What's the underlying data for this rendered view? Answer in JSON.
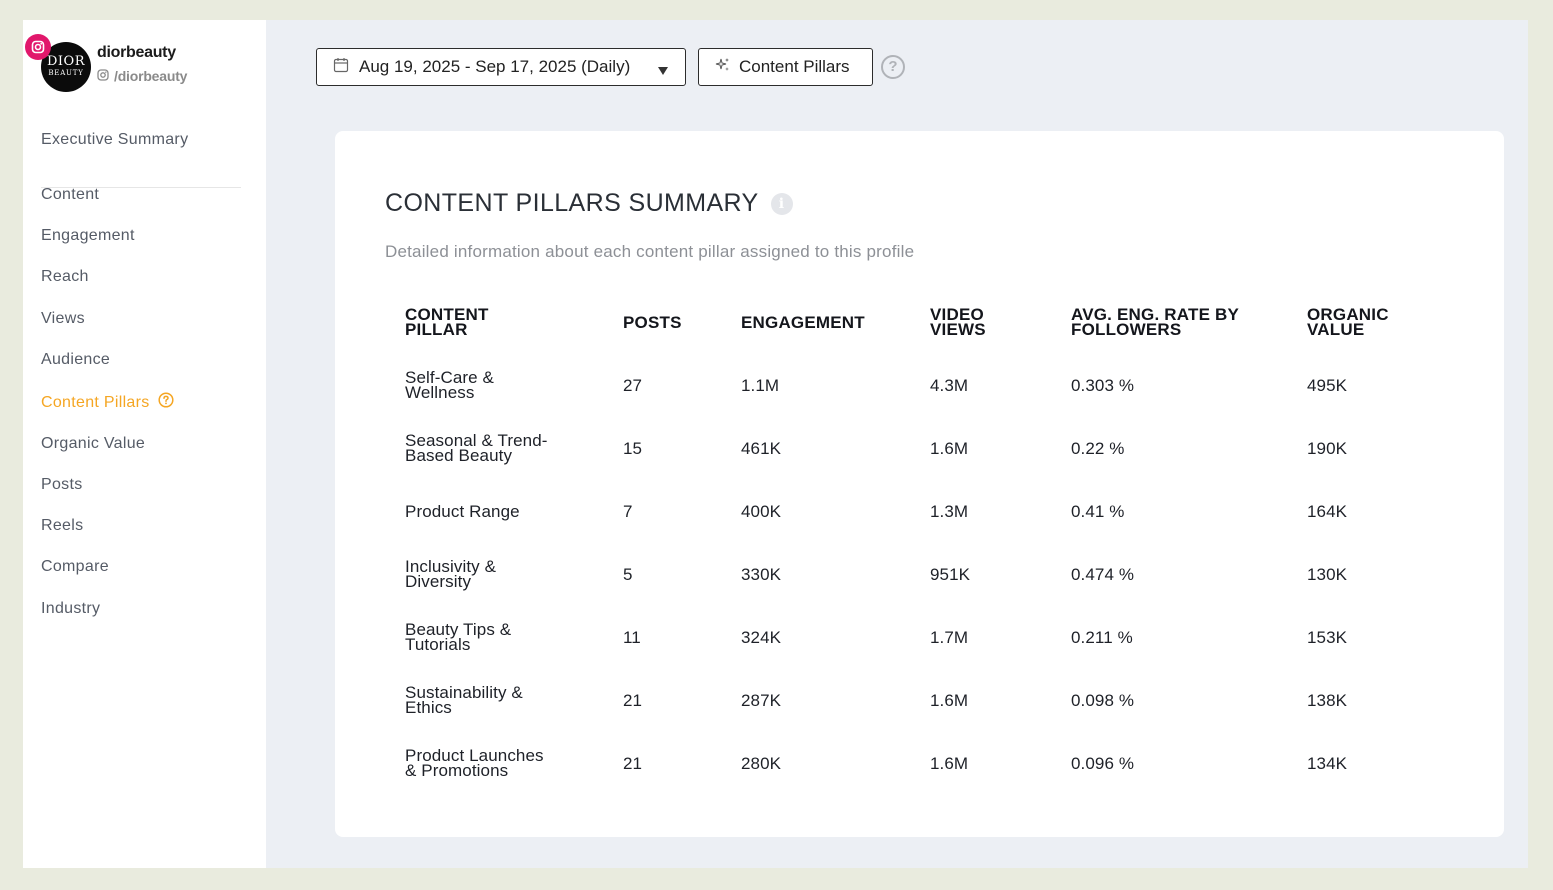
{
  "profile": {
    "name": "diorbeauty",
    "handle": "/diorbeauty",
    "avatar_line1": "DIOR",
    "avatar_line2": "BEAUTY"
  },
  "nav": {
    "items": [
      {
        "label": "Executive Summary",
        "active": false
      },
      {
        "label": "Content",
        "active": false
      },
      {
        "label": "Engagement",
        "active": false
      },
      {
        "label": "Reach",
        "active": false
      },
      {
        "label": "Views",
        "active": false
      },
      {
        "label": "Audience",
        "active": false
      },
      {
        "label": "Content Pillars",
        "active": true
      },
      {
        "label": "Organic Value",
        "active": false
      },
      {
        "label": "Posts",
        "active": false
      },
      {
        "label": "Reels",
        "active": false
      },
      {
        "label": "Compare",
        "active": false
      },
      {
        "label": "Industry",
        "active": false
      }
    ]
  },
  "toolbar": {
    "date_range": "Aug 19, 2025 - Sep 17, 2025 (Daily)",
    "pillars_label": "Content Pillars",
    "help_label": "?"
  },
  "card": {
    "title": "CONTENT PILLARS SUMMARY",
    "subtitle": "Detailed information about each content pillar assigned to this profile",
    "info_label": "i"
  },
  "table": {
    "headers": [
      {
        "line1": "CONTENT",
        "line2": "PILLAR"
      },
      {
        "line1": "POSTS",
        "line2": ""
      },
      {
        "line1": "ENGAGEMENT",
        "line2": ""
      },
      {
        "line1": "VIDEO",
        "line2": "VIEWS"
      },
      {
        "line1": "AVG. ENG. RATE BY",
        "line2": "FOLLOWERS"
      },
      {
        "line1": "ORGANIC",
        "line2": "VALUE"
      }
    ],
    "rows": [
      {
        "pillar1": "Self-Care &",
        "pillar2": "Wellness",
        "posts": "27",
        "engagement": "1.1M",
        "video_views": "4.3M",
        "avg_rate": "0.303 %",
        "organic": "495K"
      },
      {
        "pillar1": "Seasonal & Trend-",
        "pillar2": "Based Beauty",
        "posts": "15",
        "engagement": "461K",
        "video_views": "1.6M",
        "avg_rate": "0.22 %",
        "organic": "190K"
      },
      {
        "pillar1": "Product Range",
        "pillar2": "",
        "posts": "7",
        "engagement": "400K",
        "video_views": "1.3M",
        "avg_rate": "0.41 %",
        "organic": "164K"
      },
      {
        "pillar1": "Inclusivity &",
        "pillar2": "Diversity",
        "posts": "5",
        "engagement": "330K",
        "video_views": "951K",
        "avg_rate": "0.474 %",
        "organic": "130K"
      },
      {
        "pillar1": "Beauty Tips &",
        "pillar2": "Tutorials",
        "posts": "11",
        "engagement": "324K",
        "video_views": "1.7M",
        "avg_rate": "0.211 %",
        "organic": "153K"
      },
      {
        "pillar1": "Sustainability &",
        "pillar2": "Ethics",
        "posts": "21",
        "engagement": "287K",
        "video_views": "1.6M",
        "avg_rate": "0.098 %",
        "organic": "138K"
      },
      {
        "pillar1": "Product Launches",
        "pillar2": "& Promotions",
        "posts": "21",
        "engagement": "280K",
        "video_views": "1.6M",
        "avg_rate": "0.096 %",
        "organic": "134K"
      }
    ]
  },
  "colors": {
    "accent": "#f5a623",
    "instagram": "#e1176b",
    "page_bg": "#eceff4"
  },
  "icons": {
    "badge": "instagram-icon",
    "date": "calendar-icon",
    "pillars": "sparkle-icon",
    "help": "help-circle-icon",
    "info": "info-icon"
  }
}
